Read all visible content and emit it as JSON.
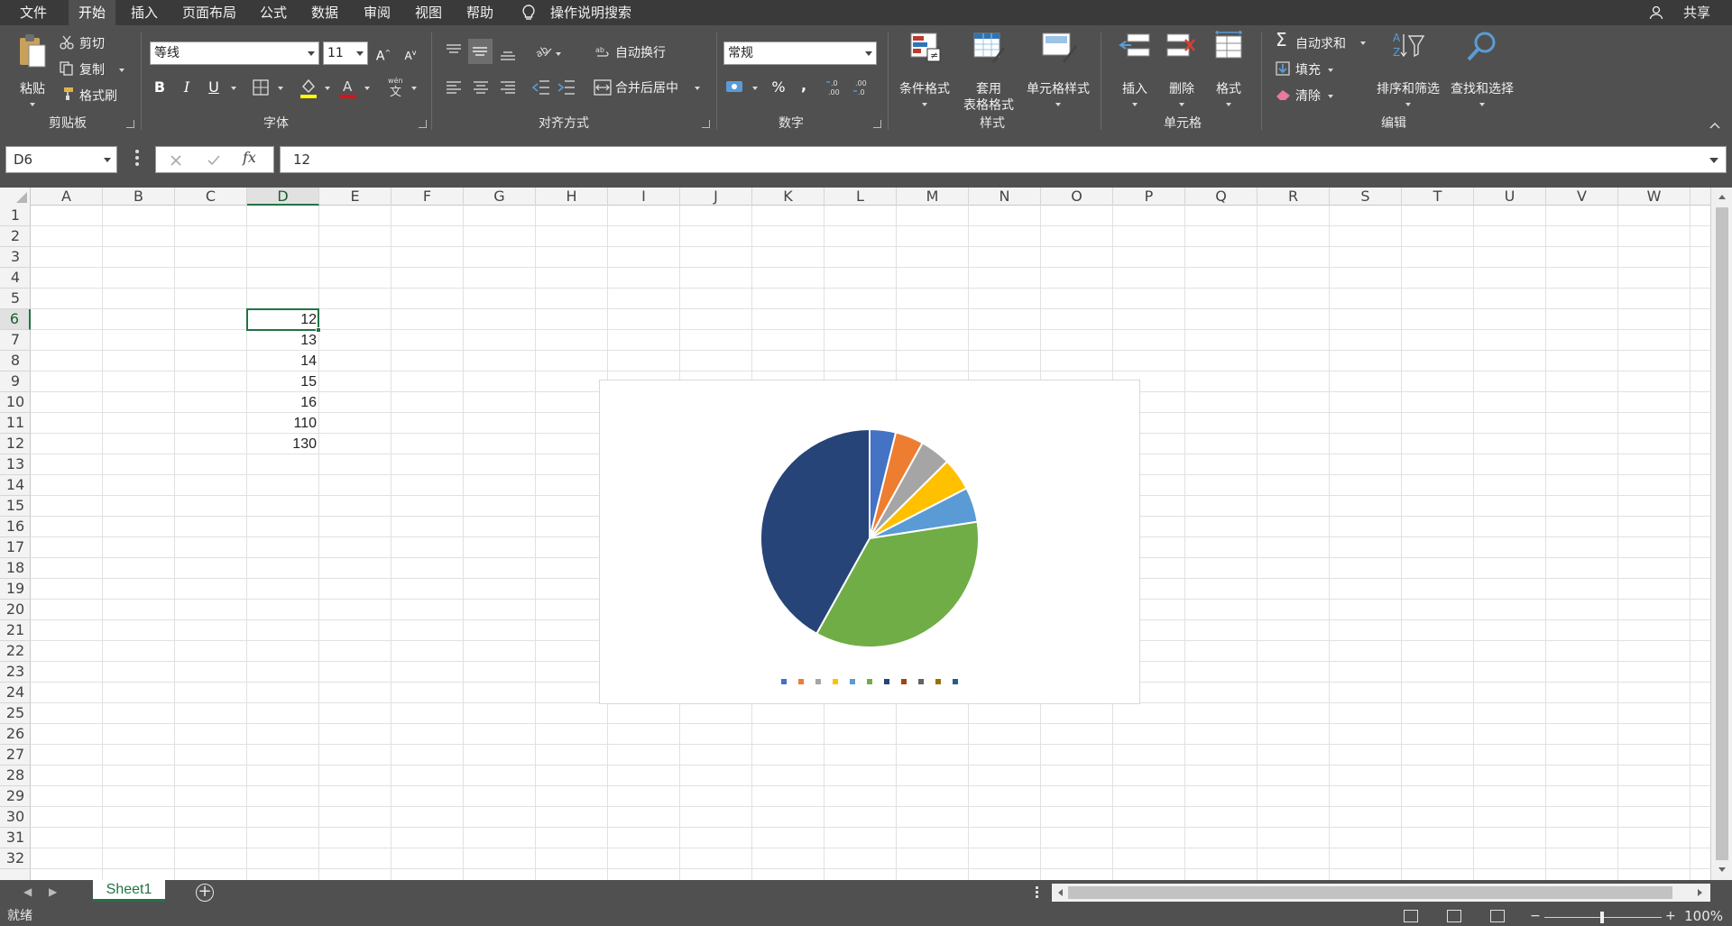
{
  "menu": {
    "tabs": [
      "文件",
      "开始",
      "插入",
      "页面布局",
      "公式",
      "数据",
      "审阅",
      "视图",
      "帮助"
    ],
    "active_index": 1,
    "tell_me": "操作说明搜索",
    "share": "共享"
  },
  "ribbon": {
    "clipboard": {
      "paste": "粘贴",
      "cut": "剪切",
      "copy": "复制",
      "format_painter": "格式刷",
      "group": "剪贴板"
    },
    "font": {
      "name": "等线",
      "size": "11",
      "bold": "B",
      "italic": "I",
      "underline": "U",
      "group": "字体"
    },
    "alignment": {
      "wrap": "自动换行",
      "merge": "合并后居中",
      "group": "对齐方式"
    },
    "number": {
      "format": "常规",
      "percent": "%",
      "comma": ",",
      "group": "数字"
    },
    "styles": {
      "conditional": "条件格式",
      "table_line1": "套用",
      "table_line2": "表格格式",
      "cell_styles": "单元格样式",
      "group": "样式"
    },
    "cells": {
      "insert": "插入",
      "delete": "删除",
      "format": "格式",
      "group": "单元格"
    },
    "editing": {
      "autosum": "自动求和",
      "fill": "填充",
      "clear": "清除",
      "sort": "排序和筛选",
      "find": "查找和选择",
      "group": "编辑"
    }
  },
  "formula_bar": {
    "name_box": "D6",
    "fx": "fx",
    "content": "12"
  },
  "grid": {
    "columns": [
      "A",
      "B",
      "C",
      "D",
      "E",
      "F",
      "G",
      "H",
      "I",
      "J",
      "K",
      "L",
      "M",
      "N",
      "O",
      "P",
      "Q",
      "R",
      "S",
      "T",
      "U",
      "V",
      "W"
    ],
    "rows": [
      "1",
      "2",
      "3",
      "4",
      "5",
      "6",
      "7",
      "8",
      "9",
      "10",
      "11",
      "12",
      "13",
      "14",
      "15",
      "16",
      "17",
      "18",
      "19",
      "20",
      "21",
      "22",
      "23",
      "24",
      "25",
      "26",
      "27",
      "28",
      "29",
      "30",
      "31",
      "32"
    ],
    "selected_column": "D",
    "selected_row": "6",
    "cells": [
      {
        "ref": "D6",
        "value": "12"
      },
      {
        "ref": "D7",
        "value": "13"
      },
      {
        "ref": "D8",
        "value": "14"
      },
      {
        "ref": "D9",
        "value": "15"
      },
      {
        "ref": "D10",
        "value": "16"
      },
      {
        "ref": "D11",
        "value": "110"
      },
      {
        "ref": "D12",
        "value": "130"
      }
    ]
  },
  "chart_data": {
    "type": "pie",
    "values": [
      12,
      13,
      14,
      15,
      16,
      110,
      130
    ],
    "colors": [
      "#4472c4",
      "#ed7d31",
      "#a5a5a5",
      "#ffc000",
      "#5b9bd5",
      "#70ad47",
      "#264478"
    ],
    "legend_colors": [
      "#4472c4",
      "#ed7d31",
      "#a5a5a5",
      "#ffc000",
      "#5b9bd5",
      "#70ad47",
      "#264478",
      "#9e480e",
      "#636363",
      "#997300",
      "#255e91"
    ],
    "legend_position": "bottom"
  },
  "sheets": [
    "Sheet1"
  ],
  "active_sheet": "Sheet1",
  "status": {
    "text": "就绪",
    "zoom": "100%"
  }
}
